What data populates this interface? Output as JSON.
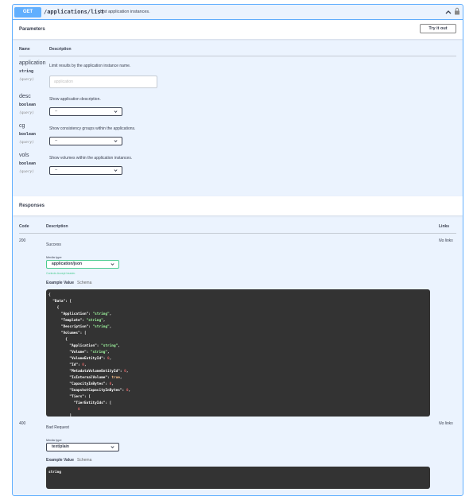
{
  "operation": {
    "method": "GET",
    "path": "/applications/list",
    "description": "List application instances."
  },
  "parameters_section": {
    "title": "Parameters",
    "try_button": "Try it out",
    "col_name": "Name",
    "col_description": "Description",
    "params": [
      {
        "name": "application",
        "type": "string",
        "in": "(query)",
        "description": "Limit results by the application instance name.",
        "placeholder": "application",
        "control": "text"
      },
      {
        "name": "desc",
        "type": "boolean",
        "in": "(query)",
        "description": "Show application description.",
        "value": "--",
        "control": "select"
      },
      {
        "name": "cg",
        "type": "boolean",
        "in": "(query)",
        "description": "Show consistency groups within the applications.",
        "value": "--",
        "control": "select"
      },
      {
        "name": "vols",
        "type": "boolean",
        "in": "(query)",
        "description": "Show volumes within the application instances.",
        "value": "--",
        "control": "select"
      }
    ]
  },
  "responses_section": {
    "title": "Responses",
    "col_code": "Code",
    "col_description": "Description",
    "col_links": "Links",
    "responses": [
      {
        "code": "200",
        "description": "Success",
        "links": "No links",
        "media_type_label": "Media type",
        "media_type": "application/json",
        "controls_accept": "Controls Accept header.",
        "tab_example": "Example Value",
        "tab_schema": "Schema"
      },
      {
        "code": "400",
        "description": "Bad Request",
        "links": "No links",
        "media_type_label": "Media type",
        "media_type": "text/plain",
        "tab_example": "Example Value",
        "tab_schema": "Schema",
        "example": "string"
      }
    ],
    "example_json_lines": [
      "{",
      "  \"Data\": [",
      "    {",
      "      \"Application\": \"string\",",
      "      \"Template\": \"string\",",
      "      \"Description\": \"string\",",
      "      \"Volumes\": [",
      "        {",
      "          \"Application\": \"string\",",
      "          \"Volume\": \"string\",",
      "          \"VolumeEntityId\": 0,",
      "          \"Id\": 0,",
      "          \"MetadataVolumeEntityId\": 0,",
      "          \"IsInternalVolume\": true,",
      "          \"CapacityInBytes\": 0,",
      "          \"SnapshotCapacityInBytes\": 0,",
      "          \"Tiers\": [",
      "            \"TierEntityIds\": [",
      "              0",
      "          ]"
    ]
  },
  "colors": {
    "get": "#61affe",
    "background": "#ebf3fe",
    "success": "#49cc90",
    "code_bg": "#333333"
  }
}
